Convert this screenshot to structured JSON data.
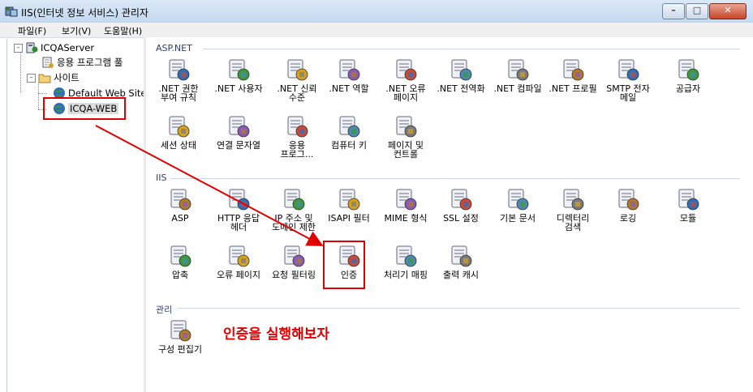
{
  "window": {
    "title": "IIS(인터넷 정보 서비스) 관리자",
    "buttons": [
      "–",
      "□",
      "✕"
    ]
  },
  "menu": [
    "파일(F)",
    "보기(V)",
    "도움말(H)"
  ],
  "tree": {
    "server": "ICQAServer",
    "app_pools": "응용 프로그램 풀",
    "sites": "사이트",
    "default_site": "Default Web Site",
    "selected_site": "ICQA-WEB"
  },
  "sections": {
    "aspnet": "ASP.NET",
    "iis": "IIS",
    "manage": "관리"
  },
  "features": {
    "aspnet": [
      {
        "label": ".NET 권한\n부여 규칙",
        "icon": "lock-user-icon"
      },
      {
        "label": ".NET 사용자",
        "icon": "users-icon"
      },
      {
        "label": ".NET 신뢰\n수준",
        "icon": "trust-check-icon"
      },
      {
        "label": ".NET 역할",
        "icon": "roles-icon"
      },
      {
        "label": ".NET 오류\n페이지",
        "icon": "error-page-icon"
      },
      {
        "label": ".NET 전역화",
        "icon": "globe-icon"
      },
      {
        "label": ".NET 컴파일",
        "icon": "compile-icon"
      },
      {
        "label": ".NET 프로필",
        "icon": "profile-icon"
      },
      {
        "label": "SMTP 전자\n메일",
        "icon": "mail-icon"
      },
      {
        "label": "공급자",
        "icon": "providers-icon"
      },
      {
        "label": "세션 상태",
        "icon": "session-icon"
      },
      {
        "label": "연결 문자열",
        "icon": "connection-string-icon"
      },
      {
        "label": "응용\n프로그...",
        "icon": "app-settings-icon"
      },
      {
        "label": "컴퓨터 키",
        "icon": "machine-key-icon"
      },
      {
        "label": "페이지 및\n컨트롤",
        "icon": "pages-controls-icon"
      }
    ],
    "iis": [
      {
        "label": "ASP",
        "icon": "asp-icon"
      },
      {
        "label": "HTTP 응답\n헤더",
        "icon": "http-headers-icon"
      },
      {
        "label": "IP 주소 및\n도메인 제한",
        "icon": "ip-restrict-icon"
      },
      {
        "label": "ISAPI 필터",
        "icon": "isapi-icon"
      },
      {
        "label": "MIME 형식",
        "icon": "mime-icon"
      },
      {
        "label": "SSL 설정",
        "icon": "ssl-lock-icon"
      },
      {
        "label": "기본 문서",
        "icon": "default-doc-icon"
      },
      {
        "label": "디렉터리\n검색",
        "icon": "dir-browse-icon"
      },
      {
        "label": "로깅",
        "icon": "logging-icon"
      },
      {
        "label": "모듈",
        "icon": "modules-icon"
      },
      {
        "label": "압축",
        "icon": "compression-icon"
      },
      {
        "label": "오류 페이지",
        "icon": "error-pages-icon"
      },
      {
        "label": "요청 필터링",
        "icon": "request-filter-icon"
      },
      {
        "label": "인증",
        "icon": "authentication-icon"
      },
      {
        "label": "처리기 매핑",
        "icon": "handler-map-icon"
      },
      {
        "label": "출력 캐시",
        "icon": "output-cache-icon"
      }
    ],
    "manage": [
      {
        "label": "구성 편집기",
        "icon": "config-editor-icon"
      }
    ]
  },
  "annotation": "인증을 실행해보자",
  "colors": {
    "highlight": "#e10000",
    "title_bg": "#c3d8ef",
    "section_text": "#2b3d6b"
  }
}
